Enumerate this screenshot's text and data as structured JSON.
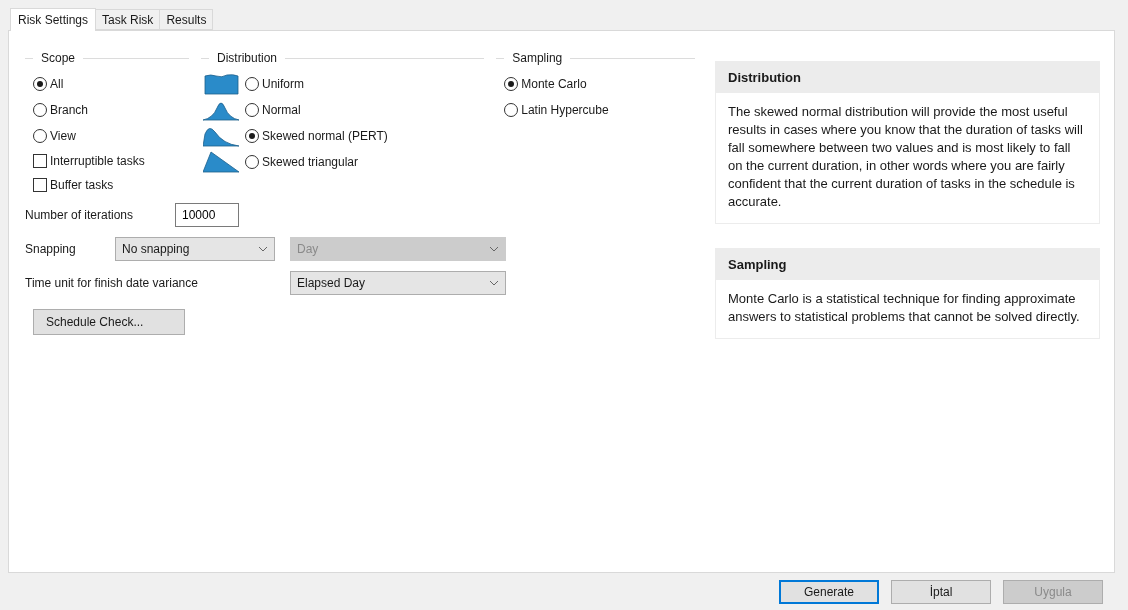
{
  "tabs": [
    {
      "label": "Risk Settings",
      "selected": true
    },
    {
      "label": "Task Risk",
      "selected": false
    },
    {
      "label": "Results",
      "selected": false
    }
  ],
  "scope": {
    "title": "Scope",
    "options": [
      {
        "label": "All",
        "selected": true
      },
      {
        "label": "Branch",
        "selected": false
      },
      {
        "label": "View",
        "selected": false
      }
    ],
    "checkboxes": [
      {
        "label": "Interruptible tasks",
        "checked": false
      },
      {
        "label": "Buffer tasks",
        "checked": false
      }
    ]
  },
  "distribution": {
    "title": "Distribution",
    "options": [
      {
        "label": "Uniform",
        "selected": false,
        "kind": "uniform"
      },
      {
        "label": "Normal",
        "selected": false,
        "kind": "normal"
      },
      {
        "label": "Skewed normal (PERT)",
        "selected": true,
        "kind": "skewed"
      },
      {
        "label": "Skewed triangular",
        "selected": false,
        "kind": "triangular"
      }
    ]
  },
  "sampling": {
    "title": "Sampling",
    "options": [
      {
        "label": "Monte Carlo",
        "selected": true
      },
      {
        "label": "Latin Hypercube",
        "selected": false
      }
    ]
  },
  "iterations": {
    "label": "Number of iterations",
    "value": "10000"
  },
  "snapping": {
    "label": "Snapping",
    "mode": {
      "value": "No snapping",
      "disabled": false
    },
    "unit": {
      "value": "Day",
      "disabled": true
    }
  },
  "time_unit": {
    "label": "Time unit for finish date variance",
    "value": "Elapsed Day",
    "disabled": false
  },
  "schedule_check": {
    "label": "Schedule Check..."
  },
  "info_panels": [
    {
      "title": "Distribution",
      "text": "The skewed normal distribution will provide the most useful results in cases where you know that the duration of tasks will fall somewhere between two values and is most likely to fall on the current duration, in other words where you are fairly confident that the current duration of tasks in the schedule is accurate."
    },
    {
      "title": "Sampling",
      "text": "Monte Carlo is a statistical technique for finding approximate answers to statistical problems that cannot be solved directly."
    }
  ],
  "buttons": [
    {
      "label": "Generate",
      "default": true,
      "disabled": false
    },
    {
      "label": "İptal",
      "default": false,
      "disabled": false
    },
    {
      "label": "Uygula",
      "default": false,
      "disabled": true
    }
  ]
}
